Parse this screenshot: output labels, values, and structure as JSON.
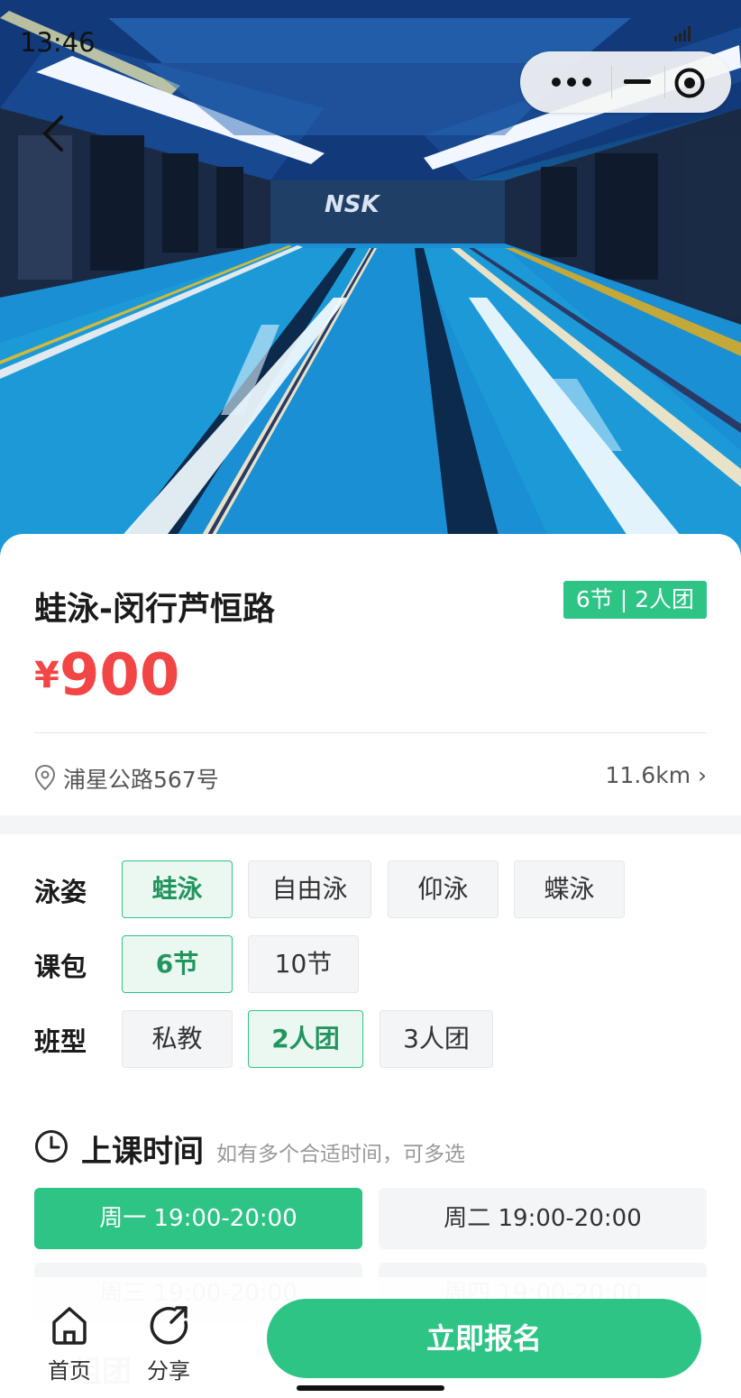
{
  "status_bar": {
    "time": "13:46",
    "signal_icon": "signal-icon"
  },
  "capsule": {
    "more_icon": "more-dots-icon",
    "minimize_icon": "minimize-icon",
    "close_icon": "target-close-icon"
  },
  "hero": {
    "image": "indoor-swimming-pool-photo",
    "back_icon": "back-chevron-icon"
  },
  "course": {
    "title": "蛙泳-闵行芦恒路",
    "badge": "6节 | 2人团",
    "currency": "¥",
    "price": "900",
    "address": "浦星公路567号",
    "distance": "11.6km ›"
  },
  "options": {
    "stroke": {
      "label": "泳姿",
      "items": [
        "蛙泳",
        "自由泳",
        "仰泳",
        "蝶泳"
      ],
      "selected": "蛙泳"
    },
    "package": {
      "label": "课包",
      "items": [
        "6节",
        "10节"
      ],
      "selected": "6节"
    },
    "class_type": {
      "label": "班型",
      "items": [
        "私教",
        "2人团",
        "3人团"
      ],
      "selected": "2人团"
    }
  },
  "schedule": {
    "title": "上课时间",
    "hint": "如有多个合适时间，可多选",
    "slots": [
      "周一 19:00-20:00",
      "周二 19:00-20:00",
      "周三 19:00-20:00",
      "周四 19:00-20:00"
    ],
    "selected": [
      "周一 19:00-20:00"
    ]
  },
  "peek_section": {
    "title": "组团"
  },
  "bottom_bar": {
    "home_label": "首页",
    "share_label": "分享",
    "signup_label": "立即报名"
  },
  "colors": {
    "accent": "#2ec486",
    "price": "#f24646",
    "chip_bg": "#f4f5f7",
    "selected_chip_bg": "#ebf8f1"
  }
}
